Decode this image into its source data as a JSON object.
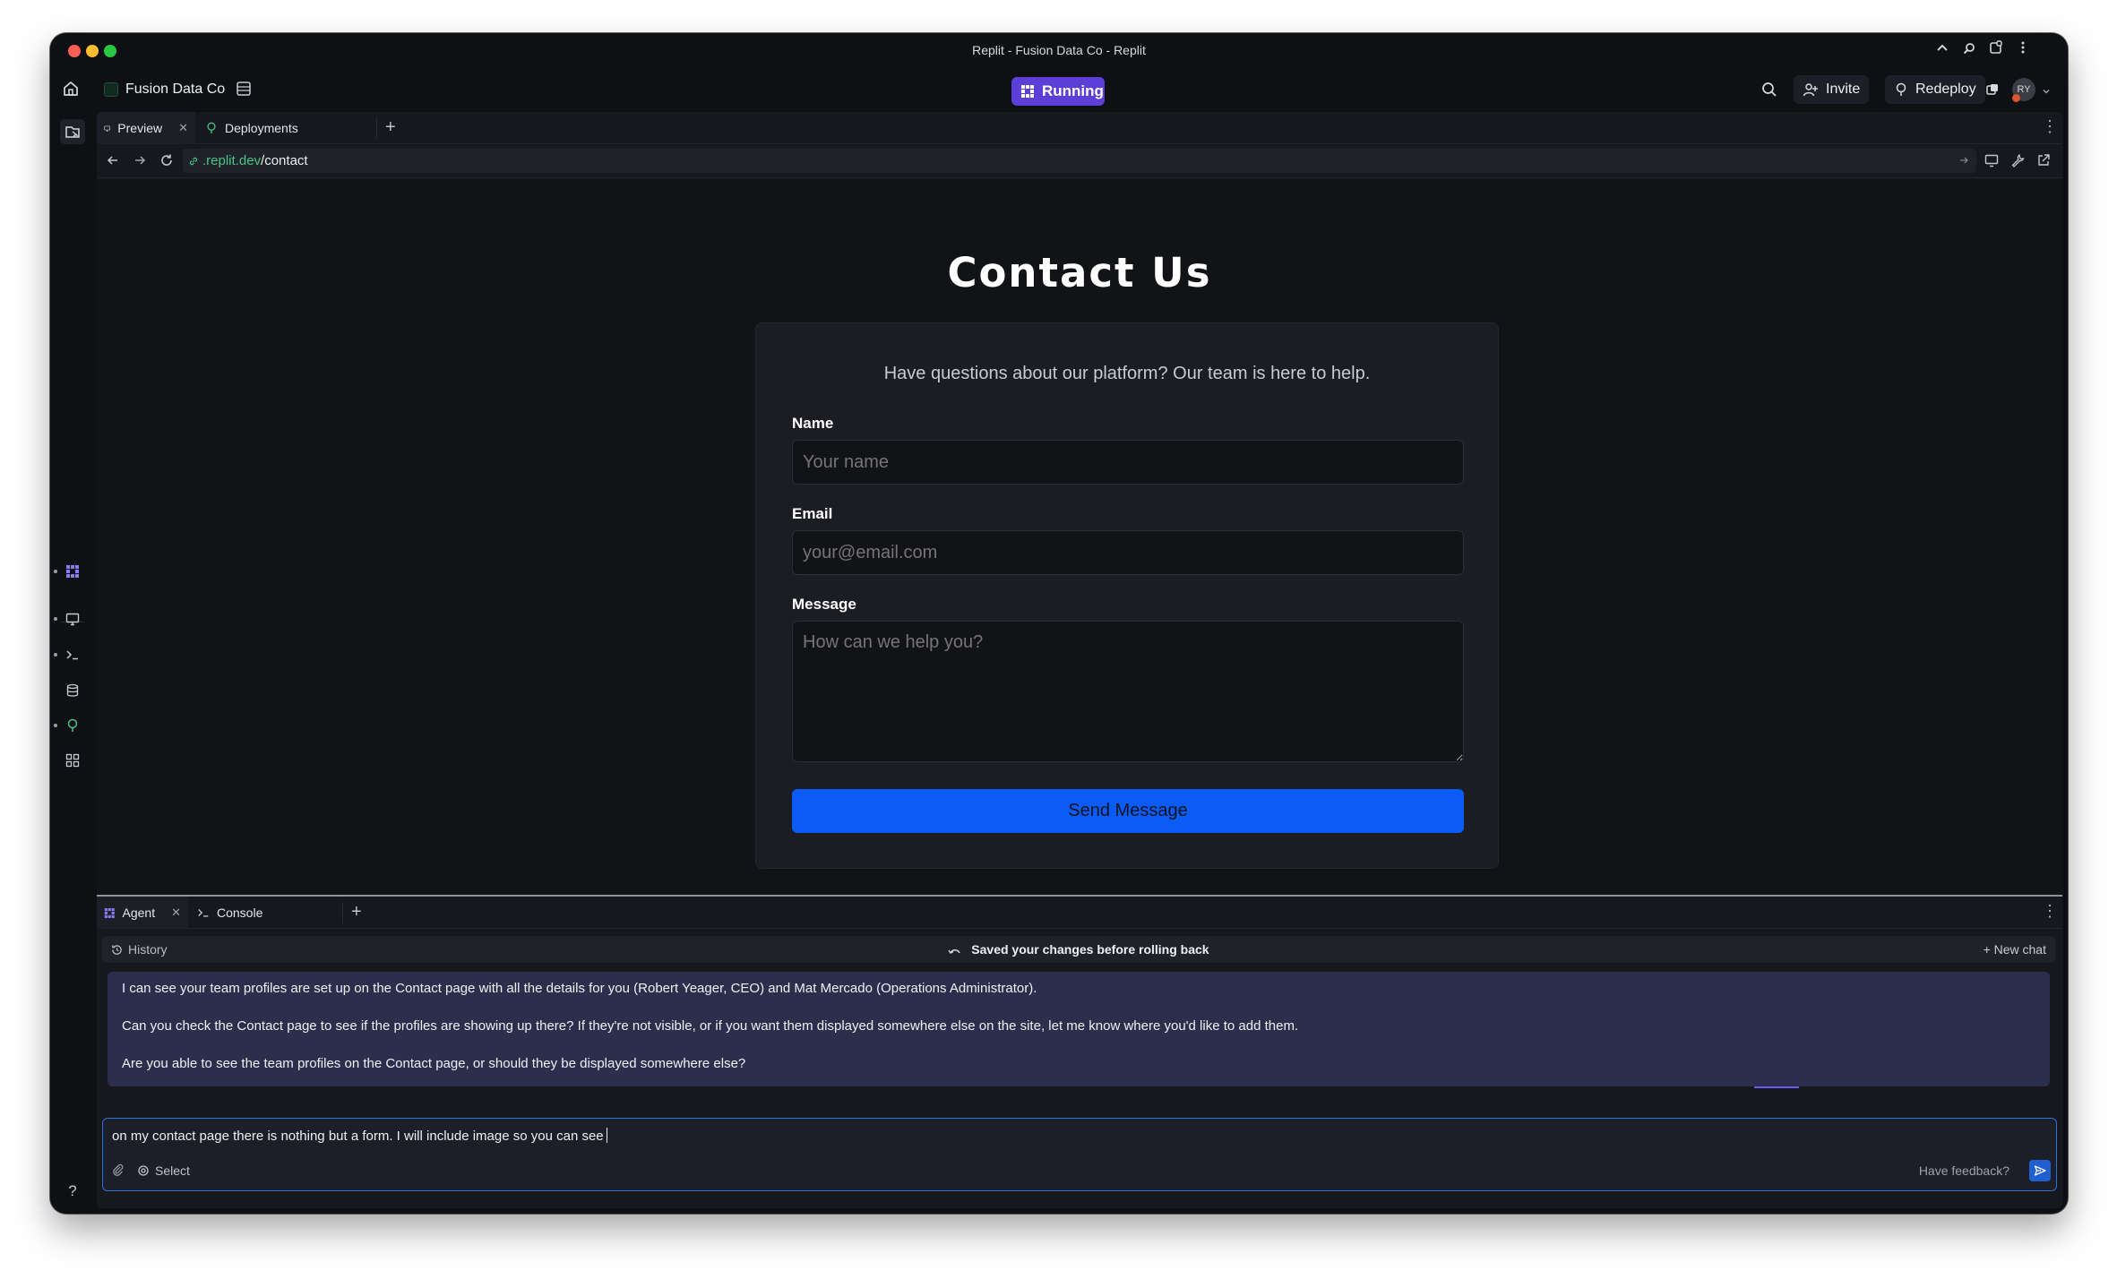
{
  "window": {
    "title": "Replit - Fusion Data Co - Replit"
  },
  "toolbar": {
    "project_name": "Fusion Data Co",
    "run_status": "Running",
    "invite_label": "Invite",
    "redeploy_label": "Redeploy",
    "avatar_initials": "RY"
  },
  "tabs": [
    {
      "label": "Preview",
      "icon": "monitor-icon"
    },
    {
      "label": "Deployments",
      "icon": "deploy-icon"
    }
  ],
  "url": {
    "host": ".replit.dev",
    "path": "/contact"
  },
  "page": {
    "title": "Contact Us",
    "subtitle": "Have questions about our platform? Our team is here to help.",
    "name_label": "Name",
    "name_placeholder": "Your name",
    "email_label": "Email",
    "email_placeholder": "your@email.com",
    "message_label": "Message",
    "message_placeholder": "How can we help you?",
    "submit_label": "Send Message"
  },
  "agent": {
    "tabs": [
      {
        "label": "Agent"
      },
      {
        "label": "Console"
      }
    ],
    "history_label": "History",
    "status_text": "Saved your changes before rolling back",
    "new_chat_label": "+ New chat",
    "messages": [
      "I can see your team profiles are set up on the Contact page with all the details for you (Robert Yeager, CEO) and Mat Mercado (Operations Administrator).",
      "Can you check the Contact page to see if the profiles are showing up there? If they're not visible, or if you want them displayed somewhere else on the site, let me know where you'd like to add them.",
      "Are you able to see the team profiles on the Contact page, or should they be displayed somewhere else?"
    ],
    "input_value": "on my contact page there is nothing but a form. I will include image so you can see",
    "select_label": "Select",
    "feedback_label": "Have feedback?"
  },
  "colors": {
    "accent": "#5b3fd6",
    "primary_button": "#0b5cf6",
    "url_host": "#4cc38a",
    "agent_bubble": "#2c2f4c"
  }
}
